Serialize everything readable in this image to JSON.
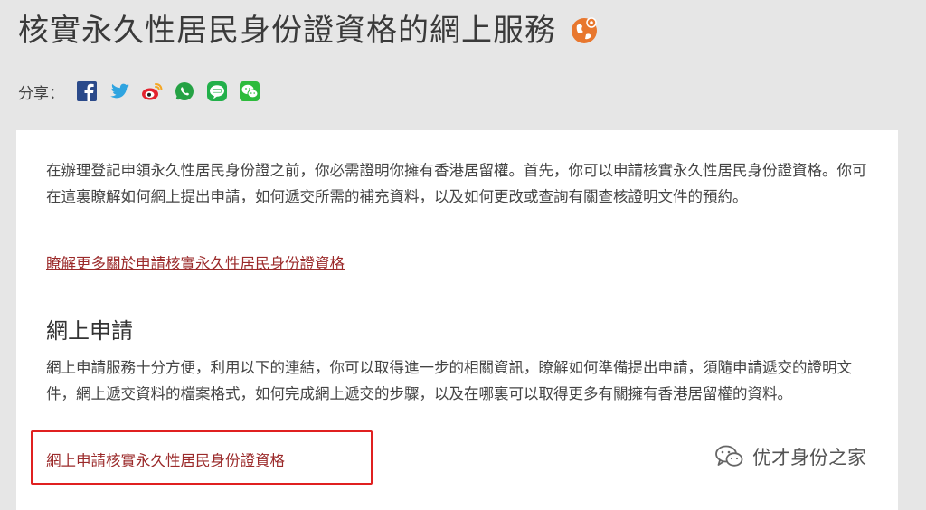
{
  "page": {
    "title": "核實永久性居民身份證資格的網上服務"
  },
  "share": {
    "label": "分享：",
    "icons": [
      "facebook-icon",
      "twitter-icon",
      "weibo-icon",
      "whatsapp-icon",
      "line-icon",
      "wechat-icon"
    ]
  },
  "intro": {
    "text": "在辦理登記申領永久性居民身份證之前，你必需證明你擁有香港居留權。首先，你可以申請核實永久性居民身份證資格。你可在這裏瞭解如何網上提出申請，如何遞交所需的補充資料，以及如何更改或查詢有關查核證明文件的預約。",
    "link": "瞭解更多關於申請核實永久性居民身份證資格"
  },
  "online": {
    "heading": "網上申請",
    "text": "網上申請服務十分方便，利用以下的連結，你可以取得進一步的相關資訊，瞭解如何準備提出申請，須隨申請遞交的證明文件，網上遞交資料的檔案格式，如何完成網上遞交的步驟，以及在哪裏可以取得更多有關擁有香港居留權的資料。",
    "link": "網上申請核實永久性居民身份證資格"
  },
  "watermark": {
    "text": "优才身份之家"
  },
  "colors": {
    "background": "#e6e6e6",
    "card": "#ffffff",
    "link": "#9b2a2a",
    "highlight": "#e02020",
    "title_icon": "#e8772e"
  }
}
